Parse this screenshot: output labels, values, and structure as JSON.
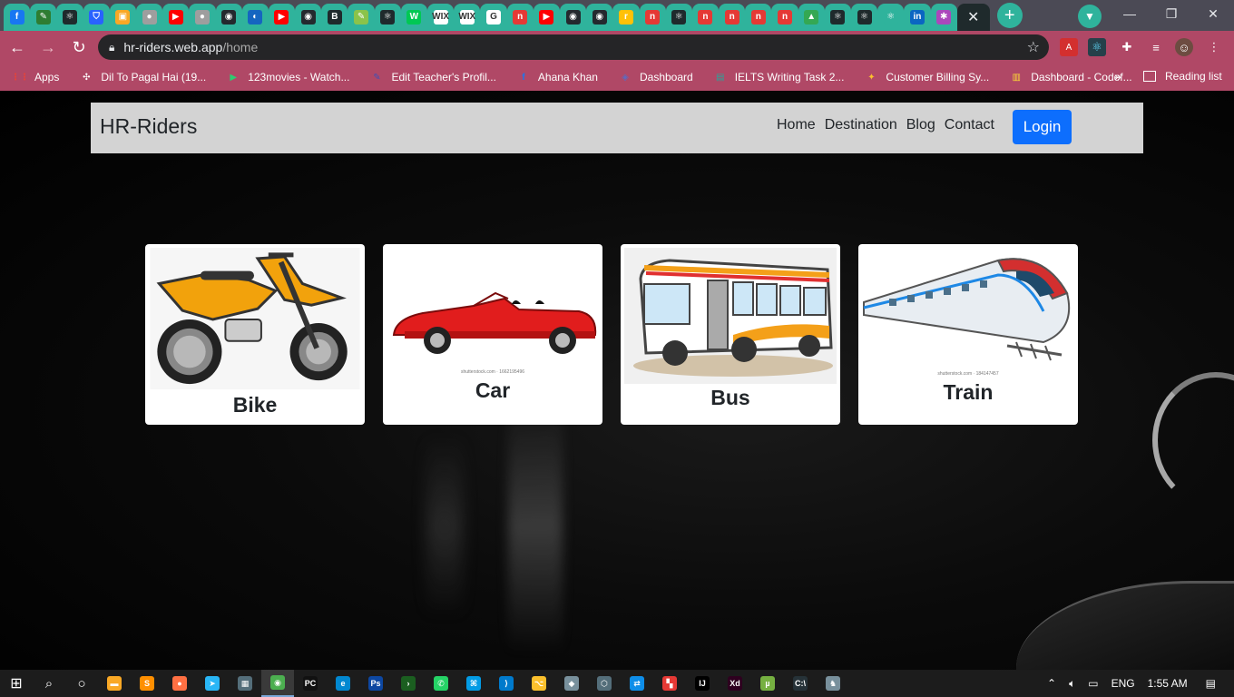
{
  "browser": {
    "tabs": [
      {
        "icon": "facebook-icon",
        "glyph": "f",
        "color": "#1877f2"
      },
      {
        "icon": "leaf-icon",
        "glyph": "✎",
        "color": "#2e7d32"
      },
      {
        "icon": "react-icon",
        "glyph": "⚛",
        "color": "#1f2a2c"
      },
      {
        "icon": "shield-icon",
        "glyph": "⛉",
        "color": "#2962ff"
      },
      {
        "icon": "calc-icon",
        "glyph": "▣",
        "color": "#f9a825"
      },
      {
        "icon": "globe-icon",
        "glyph": "●",
        "color": "#9e9e9e"
      },
      {
        "icon": "youtube-icon",
        "glyph": "▶",
        "color": "#ff0000"
      },
      {
        "icon": "globe-icon",
        "glyph": "●",
        "color": "#9e9e9e"
      },
      {
        "icon": "github-icon",
        "glyph": "◉",
        "color": "#24292e"
      },
      {
        "icon": "scribble-icon",
        "glyph": "◐",
        "color": "#1565c0"
      },
      {
        "icon": "youtube-icon",
        "glyph": "▶",
        "color": "#ff0000"
      },
      {
        "icon": "github-icon",
        "glyph": "◉",
        "color": "#24292e"
      },
      {
        "icon": "codesandbox-icon",
        "glyph": "B",
        "color": "#1f2a2c"
      },
      {
        "icon": "leaf-icon",
        "glyph": "✎",
        "color": "#8bc34a"
      },
      {
        "icon": "react-icon",
        "glyph": "⚛",
        "color": "#1f2a2c"
      },
      {
        "icon": "w-icon",
        "glyph": "W",
        "color": "#00c853"
      },
      {
        "icon": "wix-icon",
        "glyph": "WIX",
        "color": "#ffffff"
      },
      {
        "icon": "wix-icon",
        "glyph": "WIX",
        "color": "#ffffff"
      },
      {
        "icon": "google-icon",
        "glyph": "G",
        "color": "#ffffff"
      },
      {
        "icon": "n-icon",
        "glyph": "n",
        "color": "#e53935"
      },
      {
        "icon": "youtube-icon",
        "glyph": "▶",
        "color": "#ff0000"
      },
      {
        "icon": "github-icon",
        "glyph": "◉",
        "color": "#24292e"
      },
      {
        "icon": "github-icon",
        "glyph": "◉",
        "color": "#24292e"
      },
      {
        "icon": "realme-icon",
        "glyph": "r",
        "color": "#ffc107"
      },
      {
        "icon": "n-icon",
        "glyph": "n",
        "color": "#e53935"
      },
      {
        "icon": "react-icon",
        "glyph": "⚛",
        "color": "#1f2a2c"
      },
      {
        "icon": "n-icon",
        "glyph": "n",
        "color": "#e53935"
      },
      {
        "icon": "n-icon",
        "glyph": "n",
        "color": "#e53935"
      },
      {
        "icon": "n-icon",
        "glyph": "n",
        "color": "#e53935"
      },
      {
        "icon": "n-icon",
        "glyph": "n",
        "color": "#e53935"
      },
      {
        "icon": "drive-icon",
        "glyph": "▲",
        "color": "#34a853"
      },
      {
        "icon": "react-icon",
        "glyph": "⚛",
        "color": "#1f2a2c"
      },
      {
        "icon": "react-icon",
        "glyph": "⚛",
        "color": "#1f2a2c"
      },
      {
        "icon": "react-icon",
        "glyph": "⚛",
        "color": "#2fb39c"
      },
      {
        "icon": "linkedin-icon",
        "glyph": "in",
        "color": "#0a66c2"
      },
      {
        "icon": "paw-icon",
        "glyph": "✱",
        "color": "#ab47bc"
      }
    ],
    "url_host": "hr-riders.web.app",
    "url_path": "/home",
    "bookmarks": [
      {
        "label": "Apps",
        "icon": "apps-grid-icon",
        "glyph": "⋮⋮",
        "color": "#ea4335"
      },
      {
        "label": "Dil To Pagal Hai (19...",
        "icon": "film-icon",
        "glyph": "✣",
        "color": "#ffffff"
      },
      {
        "label": "123movies - Watch...",
        "icon": "play-icon",
        "glyph": "▶",
        "color": "#2ecc71"
      },
      {
        "label": "Edit Teacher's Profil...",
        "icon": "pen-icon",
        "glyph": "✎",
        "color": "#3f51b5"
      },
      {
        "label": "Ahana Khan",
        "icon": "facebook-icon",
        "glyph": "f",
        "color": "#1877f2"
      },
      {
        "label": "Dashboard",
        "icon": "dashboard-icon",
        "glyph": "◈",
        "color": "#5c6bc0"
      },
      {
        "label": "IELTS Writing Task 2...",
        "icon": "ielts-icon",
        "glyph": "▤",
        "color": "#26a69a"
      },
      {
        "label": "Customer Billing Sy...",
        "icon": "billing-icon",
        "glyph": "✦",
        "color": "#fbc02d"
      },
      {
        "label": "Dashboard - Codef...",
        "icon": "chart-icon",
        "glyph": "▥",
        "color": "#fdd835"
      }
    ],
    "more_glyph": "»",
    "reading_list": "Reading list"
  },
  "site": {
    "brand": "HR-Riders",
    "nav": [
      "Home",
      "Destination",
      "Blog",
      "Contact"
    ],
    "login": "Login",
    "cards": [
      {
        "title": "Bike",
        "image": "motorbike-image"
      },
      {
        "title": "Car",
        "image": "car-image",
        "watermark": "shutterstock.com · 1662195496"
      },
      {
        "title": "Bus",
        "image": "bus-image"
      },
      {
        "title": "Train",
        "image": "train-image",
        "watermark": "shutterstock.com · 184147457"
      }
    ]
  },
  "taskbar": {
    "apps": [
      {
        "icon": "file-explorer-icon",
        "glyph": "▬",
        "color": "#f9a825"
      },
      {
        "icon": "sublime-icon",
        "glyph": "S",
        "color": "#ff8f00"
      },
      {
        "icon": "firefox-icon",
        "glyph": "●",
        "color": "#ff7043"
      },
      {
        "icon": "telegram-icon",
        "glyph": "➤",
        "color": "#29b6f6"
      },
      {
        "icon": "calculator-icon",
        "glyph": "▦",
        "color": "#546e7a"
      },
      {
        "icon": "chrome-icon",
        "glyph": "◉",
        "color": "#4caf50"
      },
      {
        "icon": "pycharm-icon",
        "glyph": "PC",
        "color": "#111111"
      },
      {
        "icon": "edge-icon",
        "glyph": "e",
        "color": "#0288d1"
      },
      {
        "icon": "photoshop-icon",
        "glyph": "Ps",
        "color": "#0d47a1"
      },
      {
        "icon": "terminal-icon",
        "glyph": "›",
        "color": "#1b5e20"
      },
      {
        "icon": "whatsapp-icon",
        "glyph": "✆",
        "color": "#25d366"
      },
      {
        "icon": "network-icon",
        "glyph": "⌘",
        "color": "#039be5"
      },
      {
        "icon": "vscode-icon",
        "glyph": "⟩",
        "color": "#007acc"
      },
      {
        "icon": "git-icon",
        "glyph": "⌥",
        "color": "#fbc02d"
      },
      {
        "icon": "box-icon",
        "glyph": "◆",
        "color": "#78909c"
      },
      {
        "icon": "cube-icon",
        "glyph": "⬡",
        "color": "#546e7a"
      },
      {
        "icon": "teamviewer-icon",
        "glyph": "⇄",
        "color": "#0e8ee9"
      },
      {
        "icon": "grid-app-icon",
        "glyph": "▚",
        "color": "#e53935"
      },
      {
        "icon": "intellij-icon",
        "glyph": "IJ",
        "color": "#000000"
      },
      {
        "icon": "xd-icon",
        "glyph": "Xd",
        "color": "#2e001f"
      },
      {
        "icon": "utorrent-icon",
        "glyph": "µ",
        "color": "#76b041"
      },
      {
        "icon": "cmd-icon",
        "glyph": "C:\\",
        "color": "#263238"
      },
      {
        "icon": "horse-icon",
        "glyph": "♞",
        "color": "#78909c"
      }
    ],
    "language": "ENG",
    "time": "1:55 AM"
  }
}
